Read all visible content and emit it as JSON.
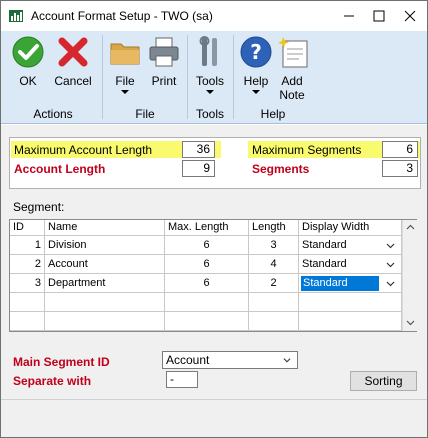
{
  "window": {
    "title": "Account Format Setup  -  TWO (sa)"
  },
  "ribbon": {
    "buttons": [
      {
        "label": "OK",
        "icon": "ok-check-icon"
      },
      {
        "label": "Cancel",
        "icon": "cancel-x-icon"
      },
      {
        "label": "File",
        "icon": "folder-icon"
      },
      {
        "label": "Print",
        "icon": "printer-icon"
      },
      {
        "label": "Tools",
        "icon": "tools-icon"
      },
      {
        "label": "Help",
        "icon": "help-icon"
      },
      {
        "label": "Add",
        "label2": "Note",
        "icon": "add-note-icon"
      }
    ],
    "groups": [
      "Actions",
      "File",
      "Tools",
      "Help"
    ]
  },
  "form": {
    "max_account_length_label": "Maximum Account Length",
    "max_account_length_value": "36",
    "account_length_label": "Account Length",
    "account_length_value": "9",
    "max_segments_label": "Maximum Segments",
    "max_segments_value": "6",
    "segments_label": "Segments",
    "segments_value": "3",
    "segment_label": "Segment:"
  },
  "grid": {
    "headers": [
      "ID",
      "Name",
      "Max. Length",
      "Length",
      "Display Width"
    ],
    "rows": [
      {
        "id": "1",
        "name": "Division",
        "max_length": "6",
        "length": "3",
        "display_width": "Standard"
      },
      {
        "id": "2",
        "name": "Account",
        "max_length": "6",
        "length": "4",
        "display_width": "Standard"
      },
      {
        "id": "3",
        "name": "Department",
        "max_length": "6",
        "length": "2",
        "display_width": "Standard"
      }
    ]
  },
  "footer_fields": {
    "main_segment_label": "Main Segment ID",
    "main_segment_value": "Account",
    "separate_label": "Separate with",
    "separate_value": "-",
    "sorting_label": "Sorting"
  },
  "colors": {
    "ribbon_bg": "#dbe8f5",
    "highlight": "#fafa6e",
    "required_red": "#c0001a",
    "selection_blue": "#0078d7"
  }
}
